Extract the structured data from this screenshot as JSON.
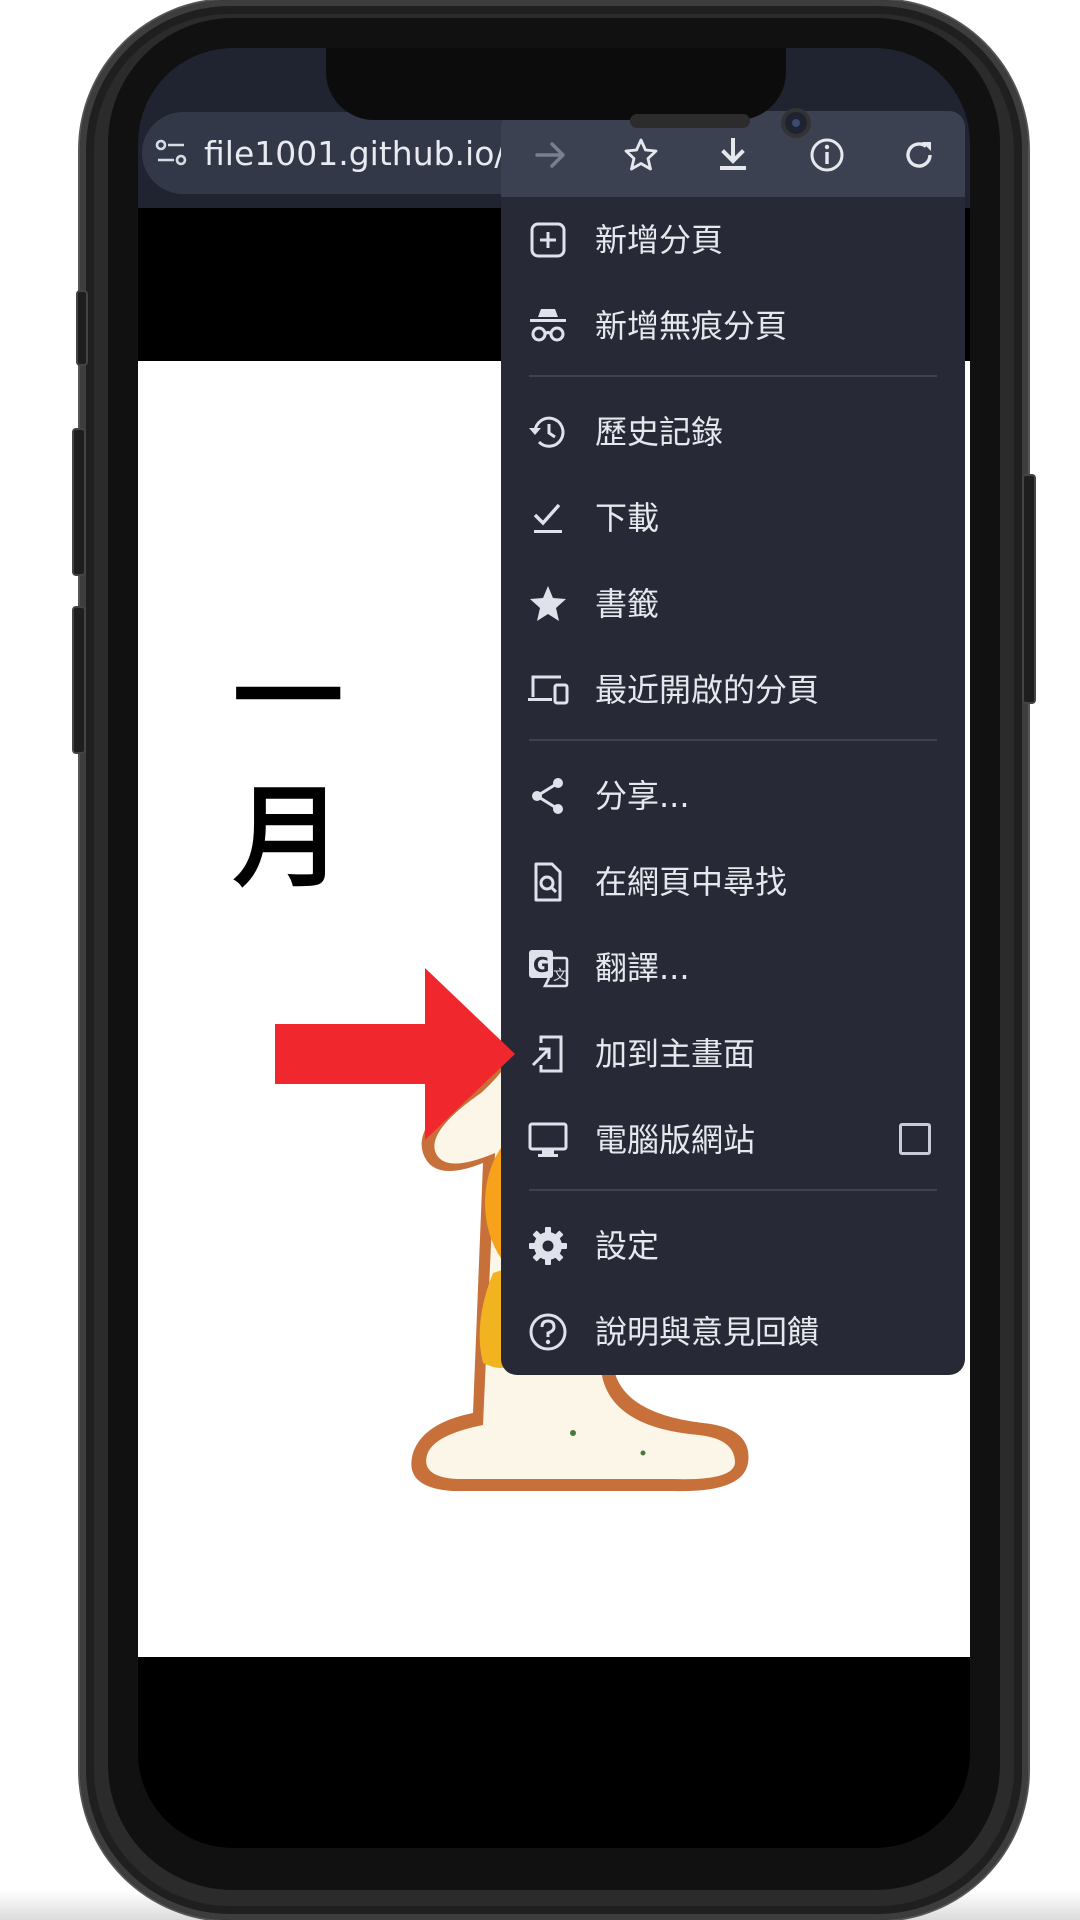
{
  "browser": {
    "url": "file1001.github.io/eg",
    "toolbar_icons": [
      "forward-icon",
      "star-icon",
      "download-icon",
      "info-icon",
      "reload-icon"
    ]
  },
  "page": {
    "vertical_title": "一\n月"
  },
  "menu": {
    "items": [
      {
        "label": "新增分頁",
        "icon": "new-tab-icon"
      },
      {
        "label": "新增無痕分頁",
        "icon": "incognito-icon"
      },
      {
        "label": "歷史記錄",
        "icon": "history-icon"
      },
      {
        "label": "下載",
        "icon": "downloads-icon"
      },
      {
        "label": "書籤",
        "icon": "bookmark-star-icon"
      },
      {
        "label": "最近開啟的分頁",
        "icon": "devices-icon"
      },
      {
        "label": "分享...",
        "icon": "share-icon"
      },
      {
        "label": "在網頁中尋找",
        "icon": "find-in-page-icon"
      },
      {
        "label": "翻譯...",
        "icon": "translate-icon"
      },
      {
        "label": "加到主畫面",
        "icon": "add-to-home-icon"
      },
      {
        "label": "電腦版網站",
        "icon": "desktop-icon",
        "checkbox_checked": false
      },
      {
        "label": "設定",
        "icon": "settings-gear-icon"
      },
      {
        "label": "說明與意見回饋",
        "icon": "help-icon"
      }
    ]
  },
  "colors": {
    "menu_bg": "#272a36",
    "toolbar_bg": "#3b4150",
    "annotation_arrow": "#f0282d"
  }
}
